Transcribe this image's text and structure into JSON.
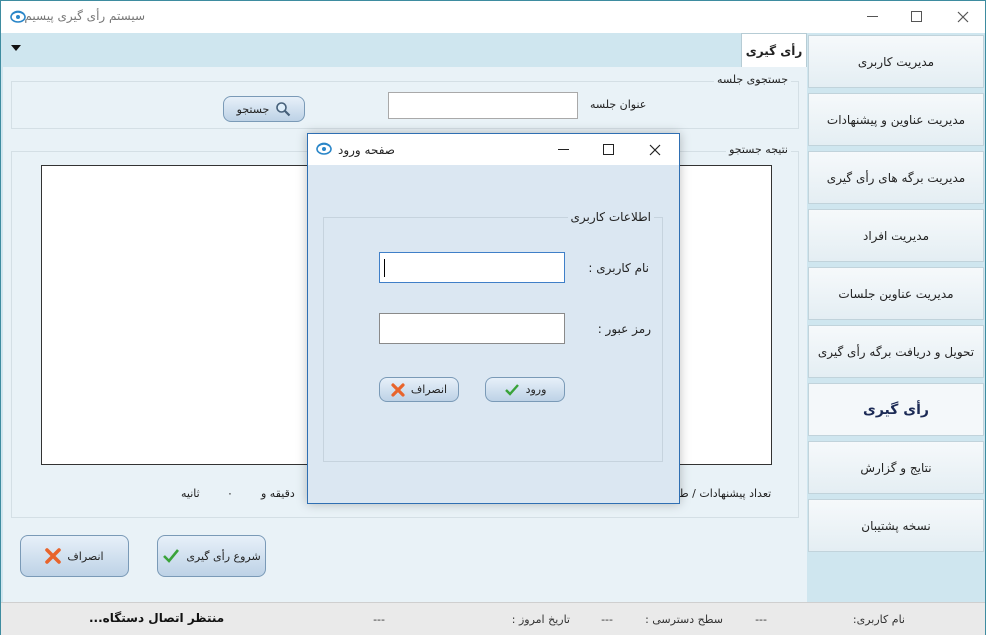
{
  "window": {
    "title": "سیستم رأی گیری  پیسیم"
  },
  "tab": {
    "label": "رأی گیری"
  },
  "sidebar": {
    "items": [
      {
        "label": "مدیریت کاربری"
      },
      {
        "label": "مدیریت عناوین و پیشنهادات"
      },
      {
        "label": "مدیریت برگه های  رأی گیری"
      },
      {
        "label": "مدیریت افراد"
      },
      {
        "label": "مدیریت عناوین جلسات"
      },
      {
        "label": "تحویل و دریافت برگه رأی گیری"
      },
      {
        "label": "رأی گیری"
      },
      {
        "label": "نتایج و گزارش"
      },
      {
        "label": "نسخه پشتیبان"
      }
    ]
  },
  "search": {
    "group_label": "جستجوی جلسه",
    "title_label": "عنوان جلسه",
    "title_value": "",
    "search_button": "جستجو"
  },
  "results": {
    "group_label": "نتیجه جستجو",
    "proposal_count_label": "تعداد پیشنهادات / ط...",
    "minutes_label": "دقیقه و",
    "seconds_value": "۰",
    "seconds_label": "ثانیه"
  },
  "actions": {
    "start_voting": "شروع رأی گیری",
    "cancel": "انصراف"
  },
  "status": {
    "username_label": "نام کاربری:",
    "username_value": "---",
    "access_label": "سطح دسترسی :",
    "access_value": "---",
    "date_label": "تاریخ امروز :",
    "date_value": "---",
    "connection": "منتظر اتصال دستگاه..."
  },
  "login_dialog": {
    "title": "صفحه ورود",
    "group_label": "اطلاعات کاربری",
    "username_label": "نام کاربری :",
    "username_value": "",
    "password_label": "رمز عبور :",
    "password_value": "",
    "login_button": "ورود",
    "cancel_button": "انصراف"
  },
  "colors": {
    "accent": "#cfe6ef",
    "ok_green": "#3aa33a",
    "cancel_orange": "#e8642c"
  }
}
